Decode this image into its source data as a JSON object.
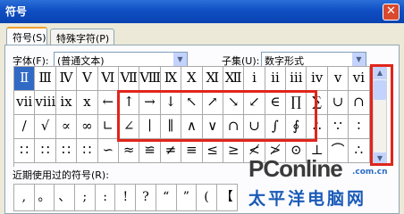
{
  "window": {
    "title": "符号",
    "close": "✕"
  },
  "tabs": [
    {
      "label": "符号(S)"
    },
    {
      "label": "特殊字符(P)"
    }
  ],
  "font_field": {
    "label": "字体(F):",
    "value": "(普通文本)"
  },
  "subset_field": {
    "label": "子集(U):",
    "value": "数字形式"
  },
  "symbols": [
    [
      "Ⅱ",
      "Ⅲ",
      "Ⅳ",
      "Ⅴ",
      "Ⅵ",
      "Ⅶ",
      "Ⅷ",
      "Ⅸ",
      "Ⅹ",
      "Ⅺ",
      "Ⅻ",
      "ⅰ",
      "ⅱ",
      "ⅲ",
      "ⅳ",
      "ⅴ",
      "ⅵ"
    ],
    [
      "ⅶ",
      "ⅷ",
      "ⅸ",
      "ⅹ",
      "←",
      "↑",
      "→",
      "↓",
      "↖",
      "↗",
      "↘",
      "↙",
      "∈",
      "∏",
      "∑",
      "∪",
      "∩"
    ],
    [
      "/",
      "√",
      "∝",
      "∞",
      "∟",
      "∠",
      "∣",
      "∥",
      "∧",
      "∨",
      "∩",
      "∪",
      "∫",
      "∮",
      "∴",
      "∵",
      "∶"
    ],
    [
      "∷",
      "∷",
      "∷",
      "∷",
      "∽",
      "≈",
      "≌",
      "≠",
      "≡",
      "≤",
      "≥",
      "≮",
      "≯",
      "⊙",
      "⊥",
      "⌒",
      "∴"
    ]
  ],
  "recent": {
    "label": "近期使用过的符号(R):",
    "symbols": [
      ",",
      "。",
      "、",
      ";",
      ":",
      "!",
      "?",
      "“",
      "”",
      "(",
      "【"
    ]
  },
  "watermark": {
    "brand": "PConline",
    "domain": ".com.cn",
    "name": "太平洋电脑网"
  }
}
